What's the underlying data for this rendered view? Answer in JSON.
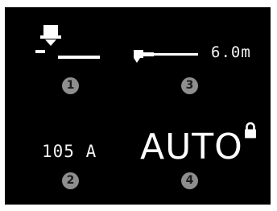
{
  "display": {
    "distance": "6.0m",
    "current": "105 A",
    "mode": "AUTO",
    "badges": [
      "1",
      "3",
      "2",
      "4"
    ]
  },
  "icons": {
    "torch_height": "torch-height-icon",
    "nozzle_distance": "nozzle-distance-icon",
    "lock": "lock-icon"
  },
  "colors": {
    "background": "#000000",
    "foreground": "#ffffff",
    "badge": "#8e8e8e"
  }
}
